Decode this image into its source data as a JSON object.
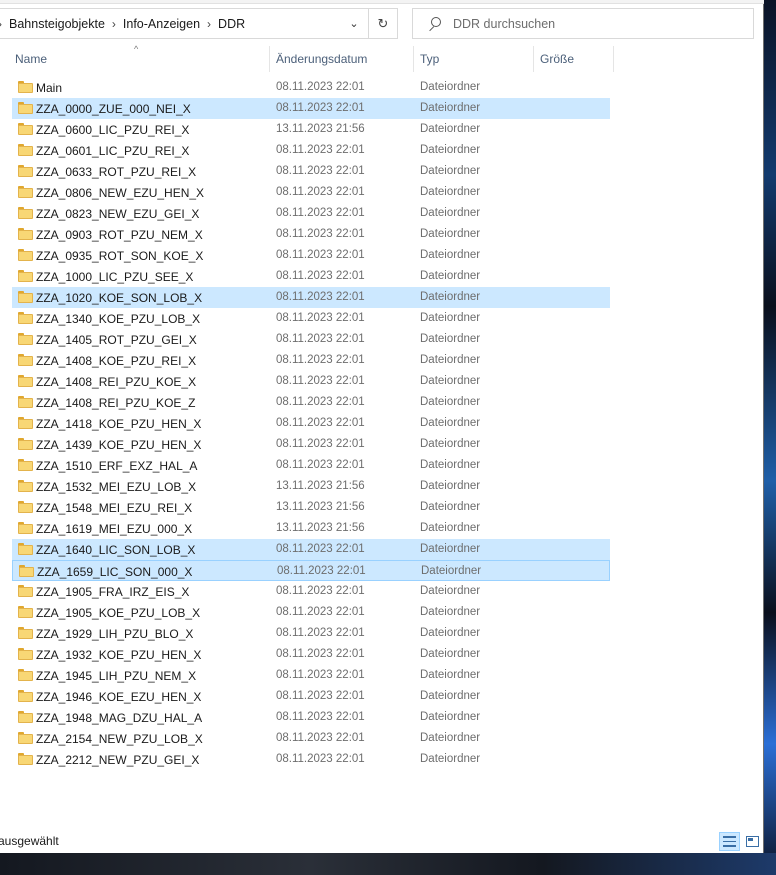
{
  "breadcrumb": {
    "items": [
      {
        "label": "Bahnsteigobjekte"
      },
      {
        "label": "Info-Anzeigen"
      },
      {
        "label": "DDR"
      }
    ]
  },
  "search": {
    "placeholder": "DDR durchsuchen"
  },
  "columns": {
    "name": "Name",
    "date": "Änderungsdatum",
    "type": "Typ",
    "size": "Größe"
  },
  "files": [
    {
      "name": "Main",
      "date": "08.11.2023 22:01",
      "type": "Dateiordner",
      "state": "normal"
    },
    {
      "name": "ZZA_0000_ZUE_000_NEI_X",
      "date": "08.11.2023 22:01",
      "type": "Dateiordner",
      "state": "selected"
    },
    {
      "name": "ZZA_0600_LIC_PZU_REI_X",
      "date": "13.11.2023 21:56",
      "type": "Dateiordner",
      "state": "normal"
    },
    {
      "name": "ZZA_0601_LIC_PZU_REI_X",
      "date": "08.11.2023 22:01",
      "type": "Dateiordner",
      "state": "normal"
    },
    {
      "name": "ZZA_0633_ROT_PZU_REI_X",
      "date": "08.11.2023 22:01",
      "type": "Dateiordner",
      "state": "normal"
    },
    {
      "name": "ZZA_0806_NEW_EZU_HEN_X",
      "date": "08.11.2023 22:01",
      "type": "Dateiordner",
      "state": "normal"
    },
    {
      "name": "ZZA_0823_NEW_EZU_GEI_X",
      "date": "08.11.2023 22:01",
      "type": "Dateiordner",
      "state": "normal"
    },
    {
      "name": "ZZA_0903_ROT_PZU_NEM_X",
      "date": "08.11.2023 22:01",
      "type": "Dateiordner",
      "state": "normal"
    },
    {
      "name": "ZZA_0935_ROT_SON_KOE_X",
      "date": "08.11.2023 22:01",
      "type": "Dateiordner",
      "state": "normal"
    },
    {
      "name": "ZZA_1000_LIC_PZU_SEE_X",
      "date": "08.11.2023 22:01",
      "type": "Dateiordner",
      "state": "normal"
    },
    {
      "name": "ZZA_1020_KOE_SON_LOB_X",
      "date": "08.11.2023 22:01",
      "type": "Dateiordner",
      "state": "selected"
    },
    {
      "name": "ZZA_1340_KOE_PZU_LOB_X",
      "date": "08.11.2023 22:01",
      "type": "Dateiordner",
      "state": "normal"
    },
    {
      "name": "ZZA_1405_ROT_PZU_GEI_X",
      "date": "08.11.2023 22:01",
      "type": "Dateiordner",
      "state": "normal"
    },
    {
      "name": "ZZA_1408_KOE_PZU_REI_X",
      "date": "08.11.2023 22:01",
      "type": "Dateiordner",
      "state": "normal"
    },
    {
      "name": "ZZA_1408_REI_PZU_KOE_X",
      "date": "08.11.2023 22:01",
      "type": "Dateiordner",
      "state": "normal"
    },
    {
      "name": "ZZA_1408_REI_PZU_KOE_Z",
      "date": "08.11.2023 22:01",
      "type": "Dateiordner",
      "state": "normal"
    },
    {
      "name": "ZZA_1418_KOE_PZU_HEN_X",
      "date": "08.11.2023 22:01",
      "type": "Dateiordner",
      "state": "normal"
    },
    {
      "name": "ZZA_1439_KOE_PZU_HEN_X",
      "date": "08.11.2023 22:01",
      "type": "Dateiordner",
      "state": "normal"
    },
    {
      "name": "ZZA_1510_ERF_EXZ_HAL_A",
      "date": "08.11.2023 22:01",
      "type": "Dateiordner",
      "state": "normal"
    },
    {
      "name": "ZZA_1532_MEI_EZU_LOB_X",
      "date": "13.11.2023 21:56",
      "type": "Dateiordner",
      "state": "normal"
    },
    {
      "name": "ZZA_1548_MEI_EZU_REI_X",
      "date": "13.11.2023 21:56",
      "type": "Dateiordner",
      "state": "normal"
    },
    {
      "name": "ZZA_1619_MEI_EZU_000_X",
      "date": "13.11.2023 21:56",
      "type": "Dateiordner",
      "state": "normal"
    },
    {
      "name": "ZZA_1640_LIC_SON_LOB_X",
      "date": "08.11.2023 22:01",
      "type": "Dateiordner",
      "state": "selected"
    },
    {
      "name": "ZZA_1659_LIC_SON_000_X",
      "date": "08.11.2023 22:01",
      "type": "Dateiordner",
      "state": "focused"
    },
    {
      "name": "ZZA_1905_FRA_IRZ_EIS_X",
      "date": "08.11.2023 22:01",
      "type": "Dateiordner",
      "state": "normal"
    },
    {
      "name": "ZZA_1905_KOE_PZU_LOB_X",
      "date": "08.11.2023 22:01",
      "type": "Dateiordner",
      "state": "normal"
    },
    {
      "name": "ZZA_1929_LIH_PZU_BLO_X",
      "date": "08.11.2023 22:01",
      "type": "Dateiordner",
      "state": "normal"
    },
    {
      "name": "ZZA_1932_KOE_PZU_HEN_X",
      "date": "08.11.2023 22:01",
      "type": "Dateiordner",
      "state": "normal"
    },
    {
      "name": "ZZA_1945_LIH_PZU_NEM_X",
      "date": "08.11.2023 22:01",
      "type": "Dateiordner",
      "state": "normal"
    },
    {
      "name": "ZZA_1946_KOE_EZU_HEN_X",
      "date": "08.11.2023 22:01",
      "type": "Dateiordner",
      "state": "normal"
    },
    {
      "name": "ZZA_1948_MAG_DZU_HAL_A",
      "date": "08.11.2023 22:01",
      "type": "Dateiordner",
      "state": "normal"
    },
    {
      "name": "ZZA_2154_NEW_PZU_LOB_X",
      "date": "08.11.2023 22:01",
      "type": "Dateiordner",
      "state": "normal"
    },
    {
      "name": "ZZA_2212_NEW_PZU_GEI_X",
      "date": "08.11.2023 22:01",
      "type": "Dateiordner",
      "state": "normal"
    }
  ],
  "status": {
    "text": "ausgewählt"
  },
  "icons": {
    "folder": "folder-icon",
    "search": "search-icon",
    "refresh": "refresh-icon",
    "dropdown": "chevron-down-icon",
    "details_view": "details-view-icon",
    "tiles_view": "large-icons-view-icon"
  },
  "colors": {
    "selection": "#cce8ff",
    "selection_border": "#99d1ff",
    "folder": "#f8d775",
    "header_text": "#4c607a"
  }
}
